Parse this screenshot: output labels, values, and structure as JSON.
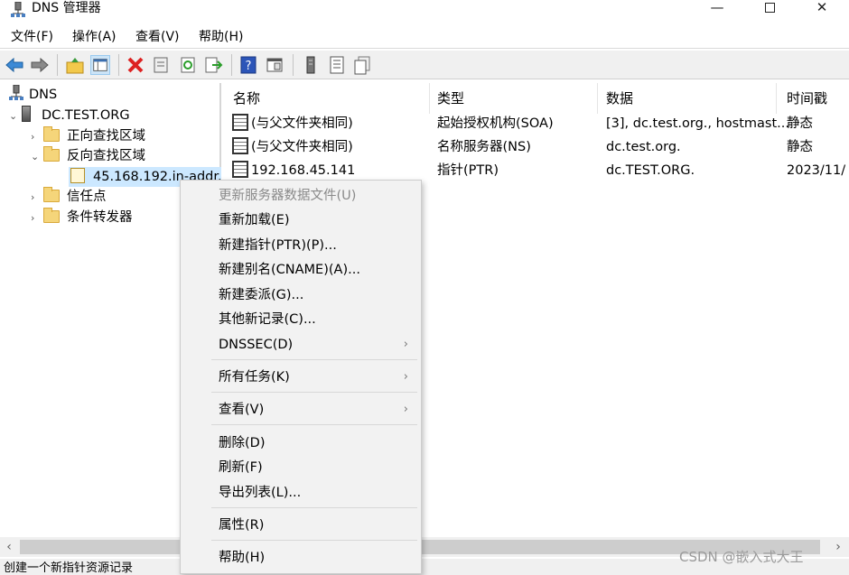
{
  "window": {
    "title": "DNS 管理器"
  },
  "menu": [
    "文件(F)",
    "操作(A)",
    "查看(V)",
    "帮助(H)"
  ],
  "toolbar_icons": [
    "back-arrow-icon",
    "forward-arrow-icon",
    "up-folder-icon",
    "show-tree-icon",
    "delete-icon",
    "properties-icon",
    "refresh-icon",
    "export-icon",
    "help-icon",
    "view-icon",
    "server-icon",
    "list-icon",
    "copy-icon"
  ],
  "tree": {
    "root": "DNS",
    "server": "DC.TEST.ORG",
    "forward_zones": "正向查找区域",
    "reverse_zones": "反向查找区域",
    "reverse_zone_child": "45.168.192.in-addr.a",
    "trust_points": "信任点",
    "forwarders": "条件转发器"
  },
  "list": {
    "columns": [
      "名称",
      "类型",
      "数据",
      "时间戳"
    ],
    "rows": [
      {
        "name": "(与父文件夹相同)",
        "type": "起始授权机构(SOA)",
        "data": "[3], dc.test.org., hostmast...",
        "timestamp": "静态"
      },
      {
        "name": "(与父文件夹相同)",
        "type": "名称服务器(NS)",
        "data": "dc.test.org.",
        "timestamp": "静态"
      },
      {
        "name": "192.168.45.141",
        "type": "指针(PTR)",
        "data": "dc.TEST.ORG.",
        "timestamp": "2023/11/"
      }
    ]
  },
  "context_menu": [
    {
      "label": "更新服务器数据文件(U)",
      "disabled": true
    },
    {
      "label": "重新加载(E)"
    },
    {
      "label": "新建指针(PTR)(P)..."
    },
    {
      "label": "新建别名(CNAME)(A)..."
    },
    {
      "label": "新建委派(G)..."
    },
    {
      "label": "其他新记录(C)..."
    },
    {
      "label": "DNSSEC(D)",
      "submenu": true
    },
    {
      "label": "所有任务(K)",
      "submenu": true
    },
    {
      "label": "查看(V)",
      "submenu": true
    },
    {
      "label": "删除(D)"
    },
    {
      "label": "刷新(F)"
    },
    {
      "label": "导出列表(L)..."
    },
    {
      "label": "属性(R)"
    },
    {
      "label": "帮助(H)"
    }
  ],
  "submenu_arrow": "›",
  "status": "创建一个新指针资源记录",
  "watermark": "CSDN @嵌入式大王"
}
